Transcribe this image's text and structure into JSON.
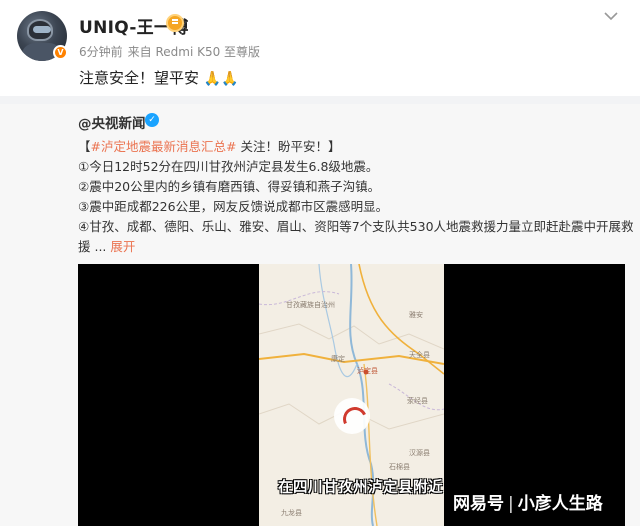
{
  "post": {
    "username": "UNIQ-王一博",
    "meta": {
      "time": "6分钟前",
      "source": "来自 Redmi K50 至尊版"
    },
    "text": "注意安全！望平安",
    "emoji": "🙏🙏"
  },
  "repost": {
    "source_name": "@央视新闻",
    "headline": {
      "bracket_open": "【",
      "hashtag": "#泸定地震最新消息汇总#",
      "rest": " 关注！盼平安！】"
    },
    "lines": [
      "①今日12时52分在四川甘孜州泸定县发生6.8级地震。",
      "②震中20公里内的乡镇有磨西镇、得妥镇和燕子沟镇。",
      "③震中距成都226公里，网友反馈说成都市区震感明显。",
      "④甘孜、成都、德阳、乐山、雅安、眉山、资阳等7个支队共530人地震救援力量立即赶赴震中开展救",
      "援 ..."
    ],
    "expand_label": "展开"
  },
  "video": {
    "caption": "在四川甘孜州泸定县附近",
    "map_labels": {
      "prefecture": "甘孜藏族自治州",
      "county": "康定",
      "dadu": "雅安",
      "luding": "泸定县",
      "tianquan": "天全县",
      "shimian": "石棉县",
      "jiulong": "九龙县",
      "hanyuan": "汉源县",
      "yingjing": "荥经县"
    }
  },
  "watermark": {
    "brand": "网易号",
    "author": "小彦人生路"
  },
  "colors": {
    "link_orange": "#eb7350",
    "verified_blue": "#1aa3ff",
    "vip_orange": "#ff8200"
  }
}
